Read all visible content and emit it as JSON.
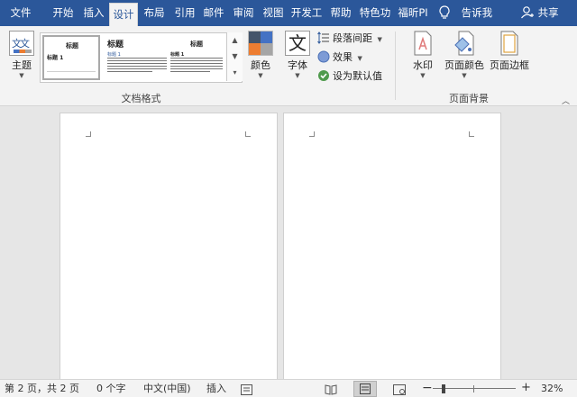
{
  "tabs": [
    {
      "label": "文件"
    },
    {
      "label": "开始"
    },
    {
      "label": "插入"
    },
    {
      "label": "设计",
      "active": true
    },
    {
      "label": "布局"
    },
    {
      "label": "引用"
    },
    {
      "label": "邮件"
    },
    {
      "label": "审阅"
    },
    {
      "label": "视图"
    },
    {
      "label": "开发工"
    },
    {
      "label": "帮助"
    },
    {
      "label": "特色功"
    },
    {
      "label": "福昕PI"
    }
  ],
  "tell_me": "告诉我",
  "share": "共享",
  "ribbon": {
    "theme_label": "主题",
    "theme_icon_text": "文文",
    "gallery": {
      "thumb1": {
        "title": "标题",
        "heading": "标题 1"
      },
      "thumb2": {
        "title": "标题",
        "heading": "标题 1"
      },
      "thumb3": {
        "title": "标题",
        "heading": "标题 1"
      }
    },
    "doc_format_label": "文档格式",
    "colors_label": "颜色",
    "fonts_label": "字体",
    "fonts_icon_text": "文",
    "paragraph_spacing": "段落间距",
    "effects": "效果",
    "set_default": "设为默认值",
    "watermark": "水印",
    "page_color": "页面颜色",
    "page_borders": "页面边框",
    "page_background_label": "页面背景"
  },
  "status": {
    "page": "第 2 页，共 2 页",
    "words": "0 个字",
    "language": "中文(中国)",
    "mode": "插入",
    "zoom": "32%"
  },
  "colors": {
    "title_bar": "#2b579a",
    "ribbon_bg": "#f3f3f3",
    "doc_bg": "#e6e6e6"
  }
}
